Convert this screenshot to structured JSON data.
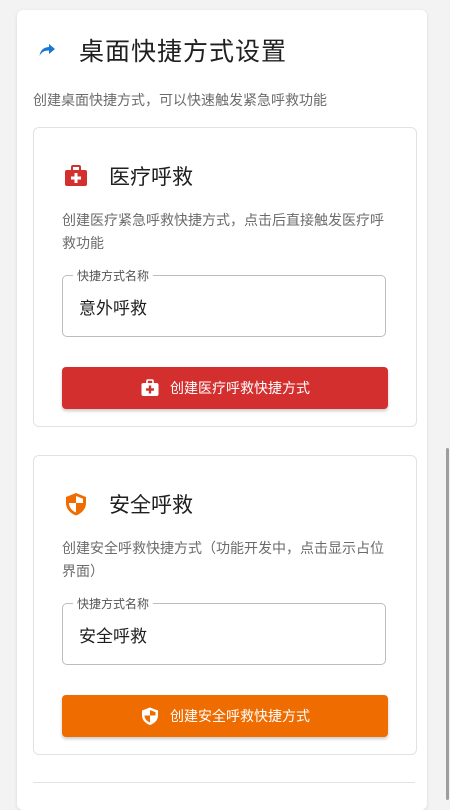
{
  "header": {
    "title": "桌面快捷方式设置",
    "subtitle": "创建桌面快捷方式，可以快速触发紧急呼救功能",
    "icon": "shortcut-arrow-icon"
  },
  "cards": [
    {
      "title": "医疗呼救",
      "icon": "medical-kit-icon",
      "description": "创建医疗紧急呼救快捷方式，点击后直接触发医疗呼救功能",
      "field_label": "快捷方式名称",
      "field_value": "意外呼救",
      "button_label": "创建医疗呼救快捷方式",
      "color": "#d32f2f"
    },
    {
      "title": "安全呼救",
      "icon": "shield-icon",
      "description": "创建安全呼救快捷方式（功能开发中，点击显示占位界面）",
      "field_label": "快捷方式名称",
      "field_value": "安全呼救",
      "button_label": "创建安全呼救快捷方式",
      "color": "#ef6c00"
    }
  ],
  "colors": {
    "accent": "#1976d2",
    "medical": "#d32f2f",
    "safety": "#ef6c00"
  }
}
